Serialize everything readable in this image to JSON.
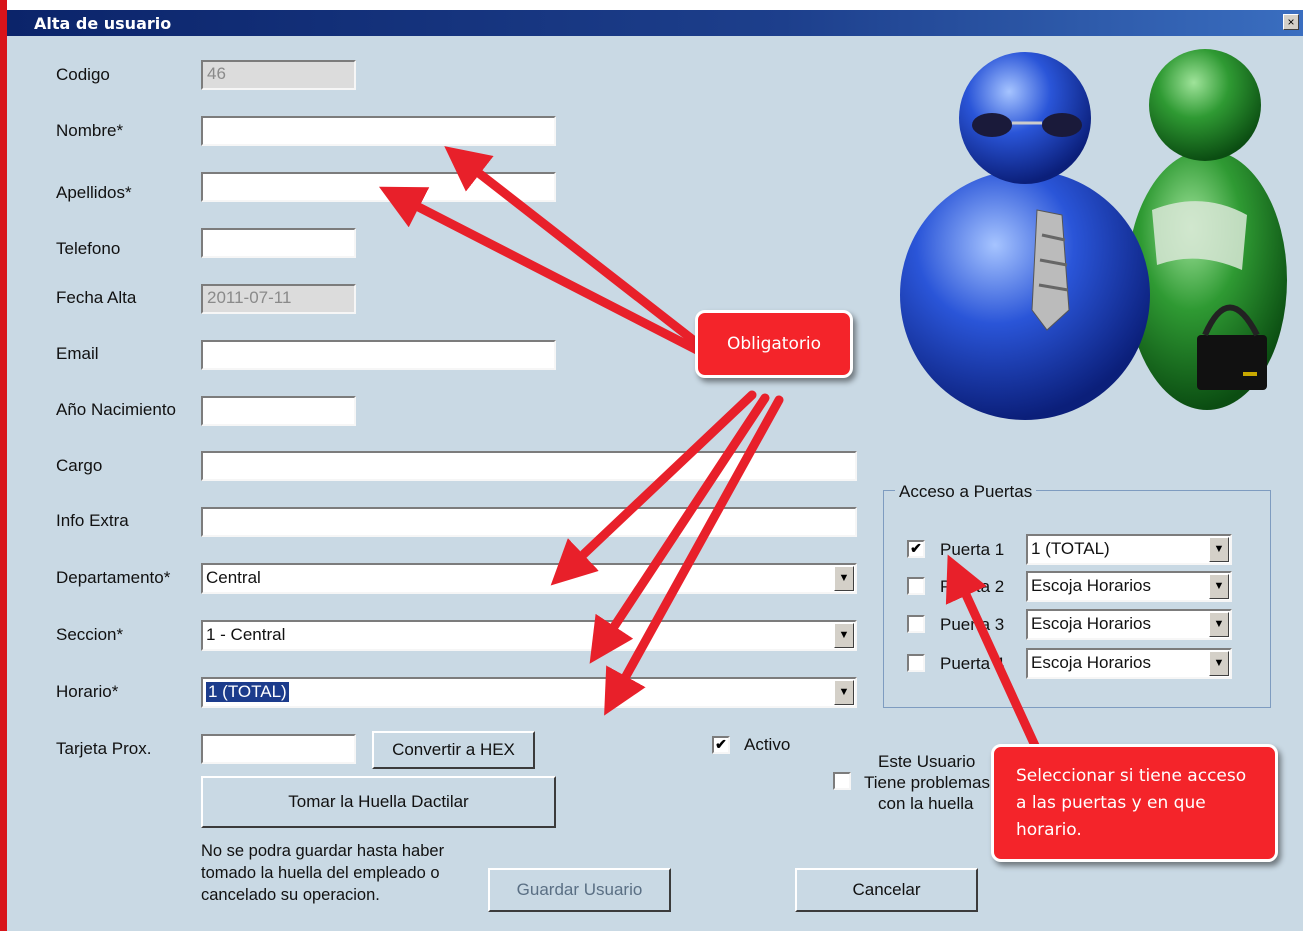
{
  "window": {
    "title": "Alta de usuario",
    "close_glyph": "×"
  },
  "fields": {
    "codigo": {
      "label": "Codigo",
      "value": "46"
    },
    "nombre": {
      "label": "Nombre*",
      "value": ""
    },
    "apellidos": {
      "label": "Apellidos*",
      "value": ""
    },
    "telefono": {
      "label": "Telefono",
      "value": ""
    },
    "fecha_alta": {
      "label": "Fecha Alta",
      "value": "2011-07-11"
    },
    "email": {
      "label": "Email",
      "value": ""
    },
    "anio_nacimiento": {
      "label": "Año Nacimiento",
      "value": ""
    },
    "cargo": {
      "label": "Cargo",
      "value": ""
    },
    "info_extra": {
      "label": "Info Extra",
      "value": ""
    },
    "departamento": {
      "label": "Departamento*",
      "value": "Central"
    },
    "seccion": {
      "label": "Seccion*",
      "value": "1 - Central"
    },
    "horario": {
      "label": "Horario*",
      "value": "1 (TOTAL)"
    },
    "tarjeta": {
      "label": "Tarjeta Prox.",
      "value": ""
    }
  },
  "buttons": {
    "convertir_hex": "Convertir a HEX",
    "tomar_huella": "Tomar la Huella Dactilar",
    "guardar": "Guardar Usuario",
    "cancelar": "Cancelar"
  },
  "activo": {
    "label": "Activo",
    "checked": true
  },
  "huella_note": "No se podra guardar hasta haber tomado la huella del empleado o cancelado su operacion.",
  "problemas_huella": {
    "line1": "Este Usuario",
    "line2": "Tiene problemas",
    "line3": "con la huella",
    "checked": false
  },
  "acceso": {
    "title": "Acceso a Puertas",
    "puertas": [
      {
        "label": "Puerta 1",
        "horario": "1 (TOTAL)",
        "checked": true
      },
      {
        "label": "Puerta 2",
        "horario": "Escoja Horarios",
        "checked": false
      },
      {
        "label": "Puerta 3",
        "horario": "Escoja Horarios",
        "checked": false
      },
      {
        "label": "Puerta 4",
        "horario": "Escoja Horarios",
        "checked": false
      }
    ]
  },
  "callouts": {
    "obligatorio": "Obligatorio",
    "seleccionar": "Seleccionar si tiene acceso a las puertas y en que horario."
  },
  "icons": {
    "check": "✔",
    "dropdown": "▼"
  },
  "colors": {
    "callout_red": "#f4242a",
    "title_blue": "#0b246a",
    "form_bg": "#c9d9e4",
    "arrow_red": "#e8202a"
  }
}
